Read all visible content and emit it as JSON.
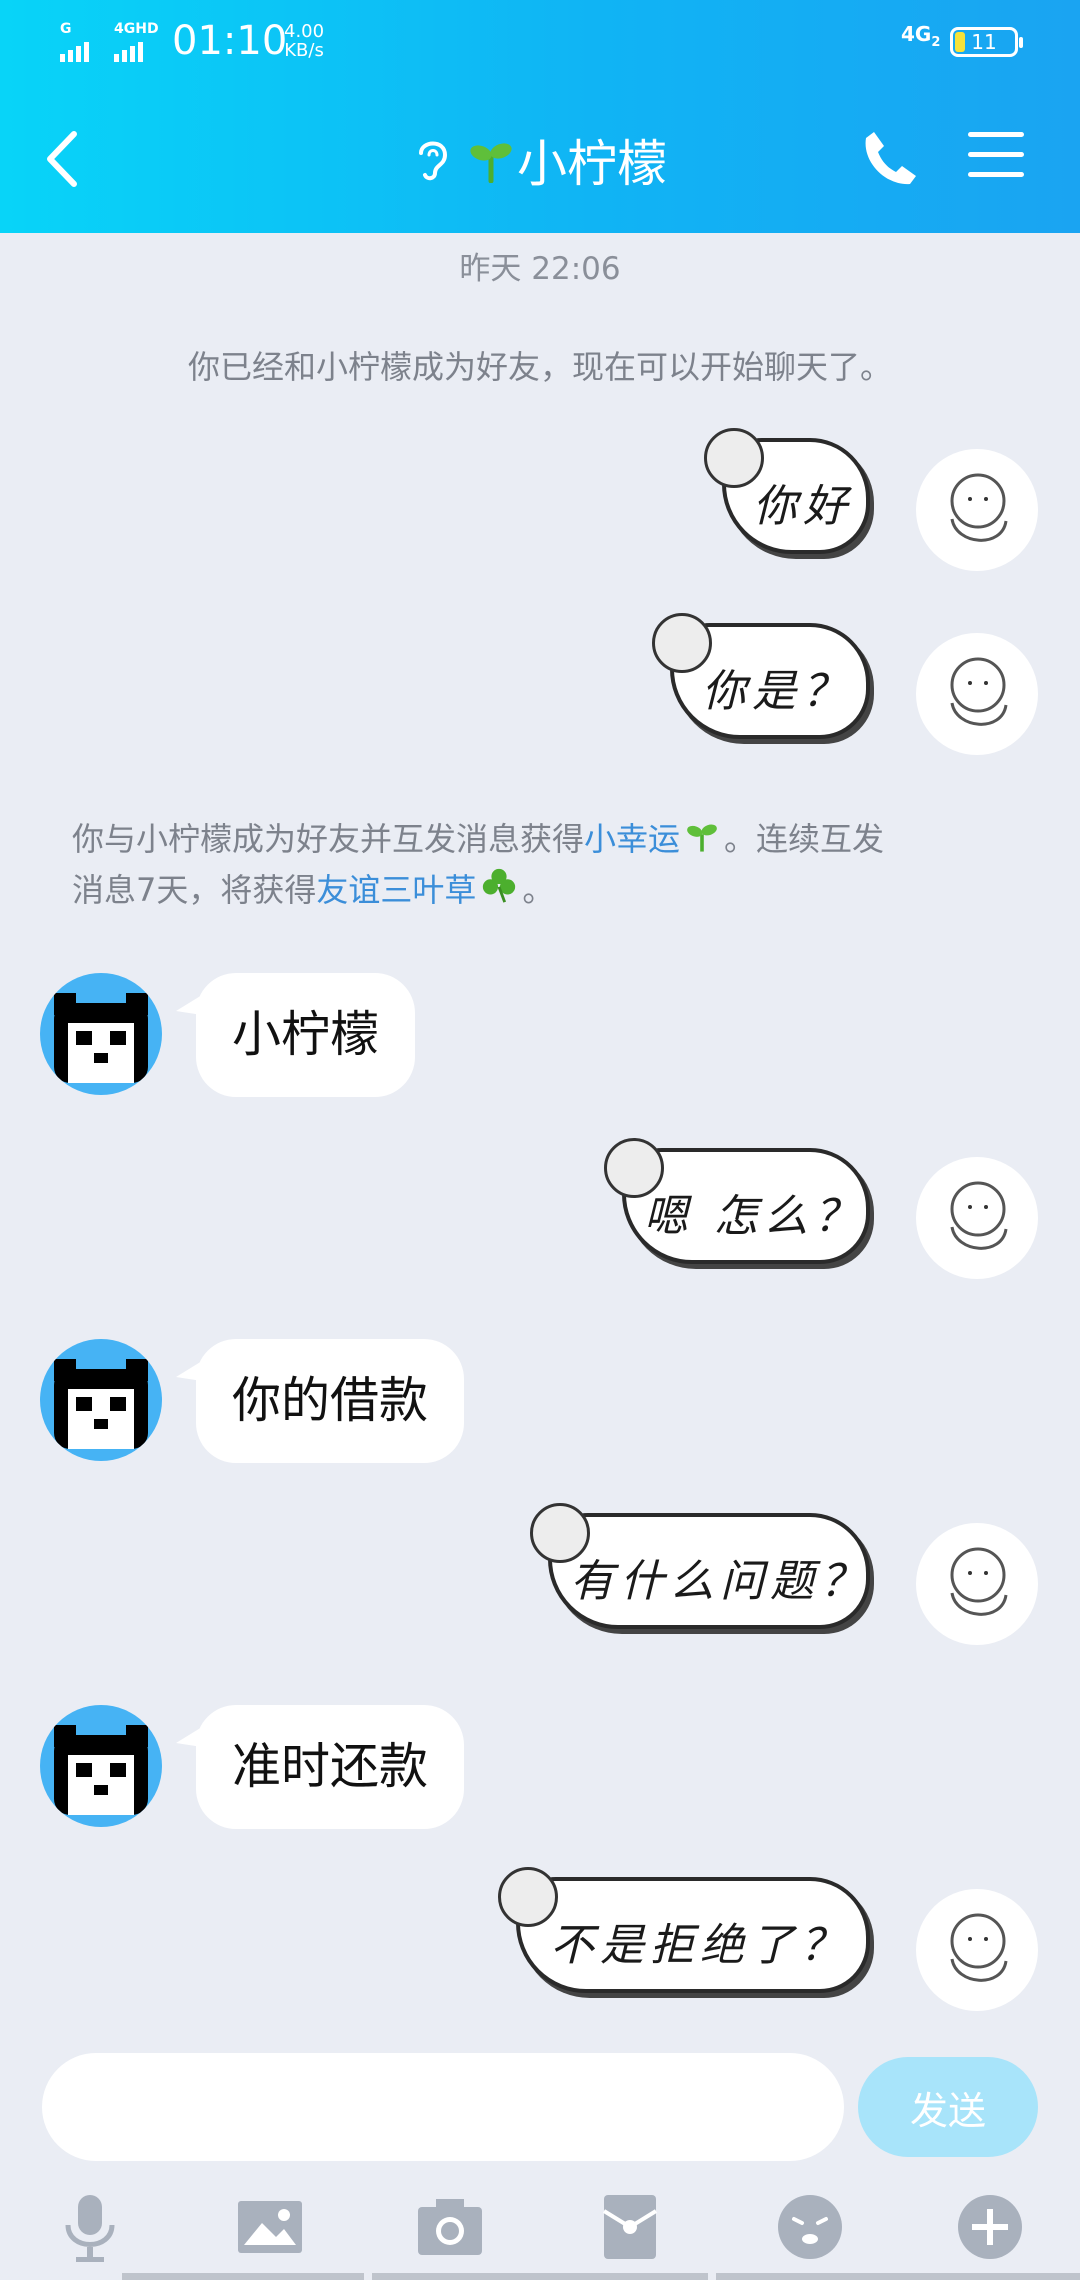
{
  "status_bar": {
    "network_top": "G",
    "network_second": "4GHD",
    "time": "01:10",
    "speed_value": "4.00",
    "speed_unit": "KB/s",
    "network_right": "4G",
    "network_right_sub": "2",
    "battery": "11"
  },
  "header": {
    "title": "小柠檬"
  },
  "chat": {
    "timestamp": "昨天 22:06",
    "system_friend_notice": "你已经和小柠檬成为好友，现在可以开始聊天了。",
    "system_reward": {
      "part1": "你与小柠檬成为好友并互发消息获得",
      "link1": "小幸运",
      "part2": "。连续互发",
      "part3": "消息7天，将获得",
      "link2": "友谊三叶草",
      "part4": "。"
    },
    "messages": [
      {
        "side": "me",
        "text": "你好"
      },
      {
        "side": "me",
        "text": "你是？"
      },
      {
        "side": "other",
        "text": "小柠檬"
      },
      {
        "side": "me",
        "text": "嗯 怎么？"
      },
      {
        "side": "other",
        "text": "你的借款"
      },
      {
        "side": "me",
        "text": "有什么问题？"
      },
      {
        "side": "other",
        "text": "准时还款"
      },
      {
        "side": "me",
        "text": "不是拒绝了？"
      }
    ]
  },
  "input": {
    "value": "",
    "placeholder": "",
    "send_label": "发送"
  },
  "toolbar": [
    "microphone-icon",
    "image-icon",
    "camera-icon",
    "red-packet-icon",
    "emoji-icon",
    "plus-icon"
  ],
  "colors": {
    "header_start": "#08d4f8",
    "header_end": "#1aa4f2",
    "background": "#eaedf4",
    "link": "#3b8ed9",
    "send_button": "#a8e4fa",
    "avatar_other_bg": "#46b3f4",
    "sprout": "#4caf2e"
  }
}
